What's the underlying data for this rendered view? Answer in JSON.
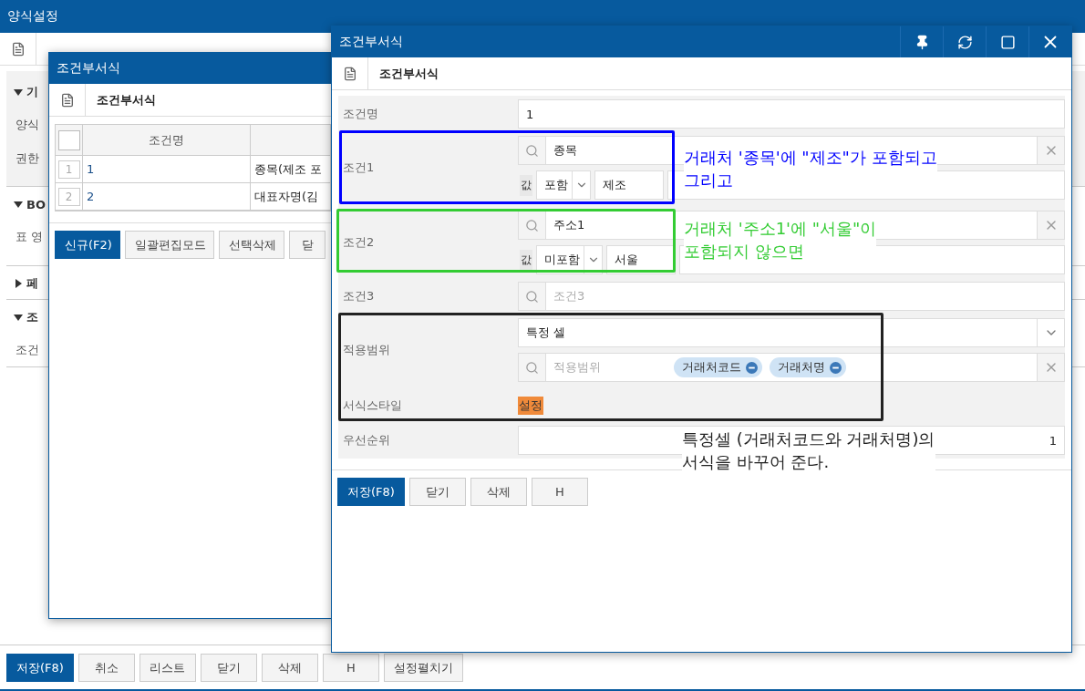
{
  "app": {
    "title": "양식설정",
    "sections": [
      {
        "title": "기",
        "expanded": true,
        "fields": [
          "양식",
          "권한"
        ]
      },
      {
        "title": "BO",
        "expanded": true,
        "fields": [
          "표 영"
        ]
      },
      {
        "title": "페",
        "expanded": false
      },
      {
        "title": "조",
        "expanded": true,
        "fields": [
          "조건"
        ]
      }
    ],
    "buttons": [
      {
        "label": "저장(F8)",
        "primary": true
      },
      {
        "label": "취소",
        "primary": false
      },
      {
        "label": "리스트",
        "primary": false
      },
      {
        "label": "닫기",
        "primary": false
      },
      {
        "label": "삭제",
        "primary": false
      },
      {
        "label": "H",
        "primary": false
      },
      {
        "label": "설정펼치기",
        "primary": false
      }
    ]
  },
  "list_dialog": {
    "title": "조건부서식",
    "header": "조건부서식",
    "all_checked": false,
    "columns": [
      "조건명"
    ],
    "rows": [
      {
        "number": "1",
        "name": "1",
        "condition": "종목(제조 포"
      },
      {
        "number": "2",
        "name": "2",
        "condition": "대표자명(김"
      }
    ],
    "buttons": [
      {
        "label": "신규(F2)",
        "primary": true
      },
      {
        "label": "일괄편집모드",
        "primary": false
      },
      {
        "label": "선택삭제",
        "primary": false
      },
      {
        "label": "닫",
        "primary": false
      }
    ]
  },
  "form_dialog": {
    "title": "조건부서식",
    "header": "조건부서식",
    "fields": [
      {
        "kind": "text",
        "label": "조건명",
        "value": "1"
      },
      {
        "kind": "condition",
        "label": "조건1",
        "field": "종목",
        "value_label": "값",
        "operator": "포함",
        "value": "제조"
      },
      {
        "kind": "condition",
        "label": "조건2",
        "field": "주소1",
        "value_label": "값",
        "operator": "미포함",
        "value": "서울"
      },
      {
        "kind": "condition",
        "label": "조건3",
        "placeholder": "조건3"
      }
    ],
    "scope": {
      "label": "적용범위",
      "select": "특정 셀",
      "placeholder": "적용범위",
      "chips": [
        "거래처코드",
        "거래처명"
      ]
    },
    "style": {
      "label": "서식스타일",
      "button": "설정"
    },
    "priority": {
      "label": "우선순위",
      "value": "1"
    },
    "buttons": [
      {
        "label": "저장(F8)",
        "primary": true
      },
      {
        "label": "닫기",
        "primary": false
      },
      {
        "label": "삭제",
        "primary": false
      },
      {
        "label": "H",
        "primary": false
      }
    ]
  },
  "annotations": [
    {
      "color": "#0000ff",
      "lines": [
        "거래처 '종목'에 \"제조\"가 포함되고",
        "그리고"
      ]
    },
    {
      "color": "#33cc33",
      "lines": [
        "거래처 '주소1'에 \"서울\"이",
        "포함되지 않으면"
      ]
    },
    {
      "color": "#222222",
      "lines": [
        "특정셀 (거래처코드와 거래처명)의",
        "서식을 바꾸어 준다."
      ]
    }
  ]
}
